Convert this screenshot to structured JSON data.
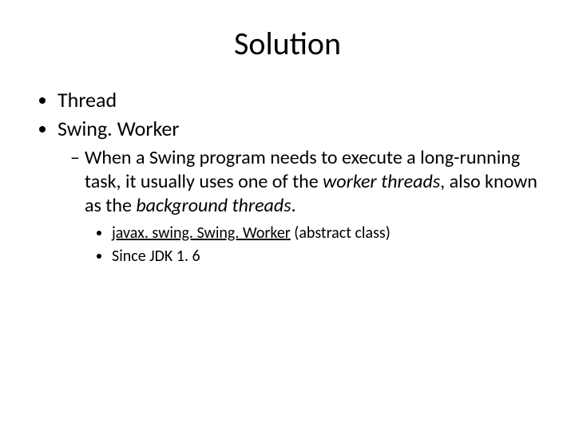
{
  "title": "Solution",
  "bullets": {
    "item1": "Thread",
    "item2": "Swing. Worker",
    "sub1_pre": "When a Swing program needs to execute a long-running task, it usually uses one of the ",
    "sub1_em1": "worker threads",
    "sub1_mid": ", also known as the ",
    "sub1_em2": "background threads",
    "sub1_post": ".",
    "sub2a_link": "javax. swing. Swing. Worker",
    "sub2a_rest": " (abstract class)",
    "sub2b": "Since JDK 1. 6"
  }
}
